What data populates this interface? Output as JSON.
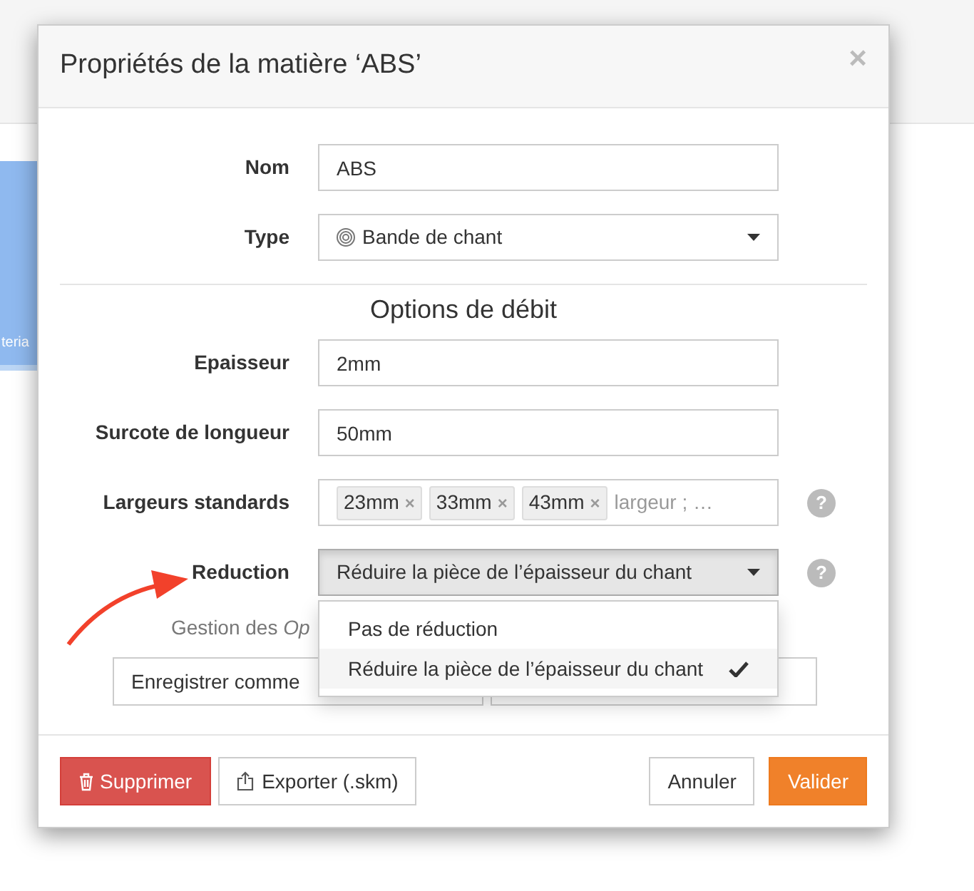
{
  "background": {
    "fragment": "teria"
  },
  "dialog": {
    "title": "Propriétés de la matière ‘ABS’",
    "close": "×"
  },
  "fields": [
    {
      "kind": "text",
      "label": "Nom",
      "value": "ABS"
    },
    {
      "kind": "select",
      "label": "Type",
      "value": "Bande de chant"
    }
  ],
  "section": {
    "heading": "Options de débit"
  },
  "options": [
    {
      "kind": "text",
      "label": "Epaisseur",
      "value": "2mm"
    },
    {
      "kind": "text",
      "label": "Surcote de longueur",
      "value": "50mm"
    },
    {
      "kind": "tags",
      "label": "Largeurs standards",
      "tags": [
        "23mm",
        "33mm",
        "43mm"
      ],
      "remove": "×",
      "placeholder": "largeur ; …",
      "help": "?"
    },
    {
      "kind": "dropdown",
      "label": "Reduction",
      "value": "Réduire la pièce de l’épaisseur du chant",
      "help": "?",
      "expanded": true
    }
  ],
  "menu": [
    {
      "label": "Pas de réduction",
      "selected": false
    },
    {
      "label": "Réduire la pièce de l’épaisseur du chant",
      "selected": true
    }
  ],
  "defaults": {
    "note": "Gestion des *Op*",
    "buttons": [
      "Enregistrer comme"
    ]
  },
  "footer": {
    "delete": "Supprimer",
    "export": "Exporter (.skm)",
    "cancel": "Annuler",
    "ok": "Valider"
  }
}
